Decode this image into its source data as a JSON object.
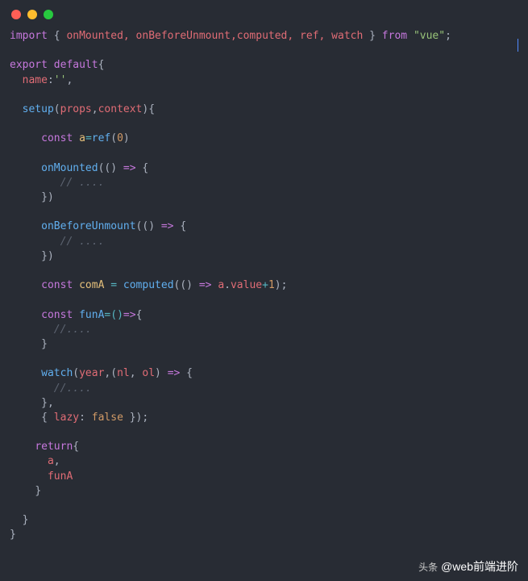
{
  "code": {
    "line1": {
      "import": "import",
      "brace_open": " { ",
      "names": "onMounted, onBeforeUnmount,computed, ref, watch",
      "brace_close": " } ",
      "from": "from",
      "space": " ",
      "quote": "\"vue\"",
      "semi": ";"
    },
    "line3": {
      "export": "export",
      "default": " default",
      "brace": "{"
    },
    "line4": {
      "indent": "  ",
      "name": "name",
      "colon": ":",
      "val": "''",
      "comma": ","
    },
    "line6": {
      "indent": "  ",
      "setup": "setup",
      "paren_open": "(",
      "props": "props",
      "comma": ",",
      "context": "context",
      "paren_close": ")",
      "brace": "{"
    },
    "line8": {
      "indent": "     ",
      "const": "const",
      "space": " ",
      "a": "a",
      "eq": "=",
      "ref": "ref",
      "paren_open": "(",
      "zero": "0",
      "paren_close": ")"
    },
    "line10": {
      "indent": "     ",
      "fn": "onMounted",
      "paren": "(() ",
      "arrow": "=>",
      "brace": " {"
    },
    "line11": {
      "indent": "        ",
      "comment": "// ...."
    },
    "line12": {
      "indent": "     ",
      "close": "})"
    },
    "line14": {
      "indent": "     ",
      "fn": "onBeforeUnmount",
      "paren": "(() ",
      "arrow": "=>",
      "brace": " {"
    },
    "line15": {
      "indent": "        ",
      "comment": "// ...."
    },
    "line16": {
      "indent": "     ",
      "close": "})"
    },
    "line18": {
      "indent": "     ",
      "const": "const",
      "space": " ",
      "comA": "comA",
      "eq": " = ",
      "computed": "computed",
      "paren": "(() ",
      "arrow": "=>",
      "space2": " ",
      "a": "a",
      "dot": ".",
      "value": "value",
      "plus": "+",
      "one": "1",
      "close": ");"
    },
    "line20": {
      "indent": "     ",
      "const": "const",
      "space": " ",
      "funA": "funA",
      "eq": "=()",
      "arrow": "=>",
      "brace": "{"
    },
    "line21": {
      "indent": "       ",
      "comment": "//...."
    },
    "line22": {
      "indent": "     ",
      "close": "}"
    },
    "line24": {
      "indent": "     ",
      "watch": "watch",
      "paren_open": "(",
      "year": "year",
      "comma": ",(",
      "nl": "nl",
      "comma2": ", ",
      "ol": "ol",
      "paren_close": ") ",
      "arrow": "=>",
      "brace": " {"
    },
    "line25": {
      "indent": "       ",
      "comment": "//...."
    },
    "line26": {
      "indent": "     ",
      "close": "},"
    },
    "line27": {
      "indent": "     ",
      "brace_open": "{ ",
      "lazy": "lazy",
      "colon": ": ",
      "false": "false",
      "close": " });"
    },
    "line29": {
      "indent": "    ",
      "return": "return",
      "brace": "{"
    },
    "line30": {
      "indent": "      ",
      "a": "a",
      "comma": ","
    },
    "line31": {
      "indent": "      ",
      "funA": "funA"
    },
    "line32": {
      "indent": "    ",
      "close": "}"
    },
    "line34": {
      "indent": "  ",
      "close": "}"
    },
    "line35": {
      "close": "}"
    }
  },
  "watermark": {
    "prefix": "头条",
    "text": "@web前端进阶"
  }
}
